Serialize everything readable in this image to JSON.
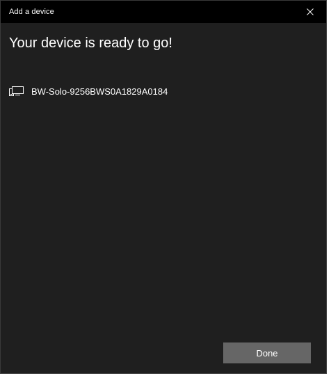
{
  "window": {
    "title": "Add a device",
    "close_icon": "close-icon"
  },
  "main": {
    "heading": "Your device is ready to go!",
    "device": {
      "icon": "device-icon",
      "name": "BW-Solo-9256BWS0A1829A0184"
    }
  },
  "footer": {
    "done_label": "Done"
  },
  "colors": {
    "window_bg": "#1f1f1f",
    "titlebar_bg": "#000000",
    "button_bg": "#666666",
    "text": "#ffffff"
  }
}
